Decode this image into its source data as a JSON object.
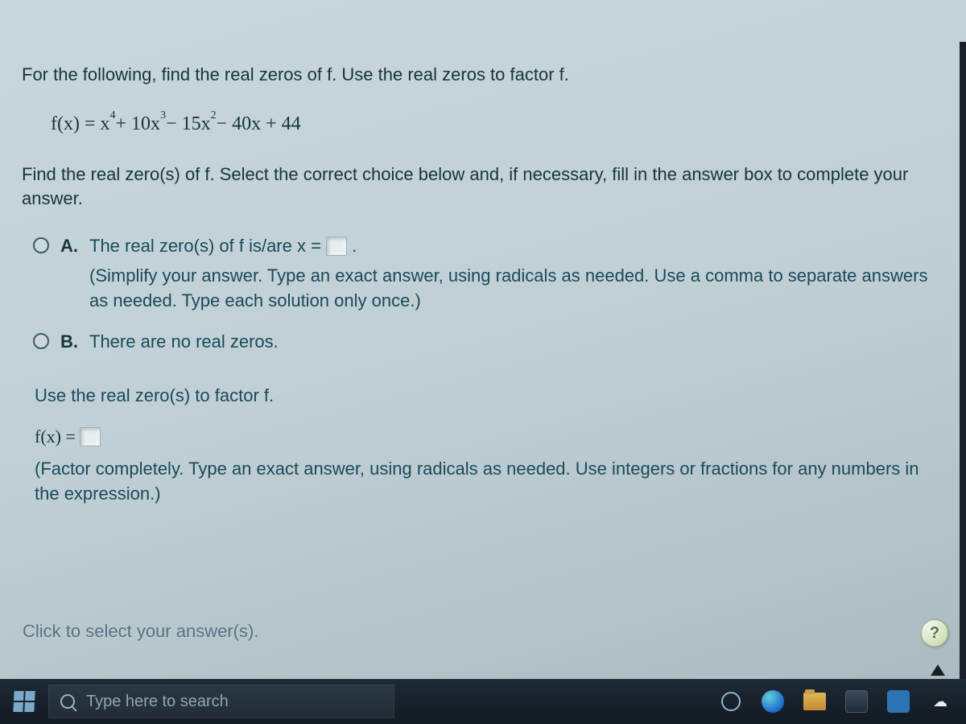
{
  "question": {
    "prompt1": "For the following, find the real zeros of f. Use the real zeros to factor f.",
    "equation_prefix": "f(x) = x",
    "equation_rest_1": " + 10x",
    "equation_rest_2": " − 15x",
    "equation_rest_3": " − 40x + 44",
    "exp4": "4",
    "exp3": "3",
    "exp2": "2",
    "prompt2": "Find the real zero(s) of f. Select the correct choice below and, if necessary, fill in the answer box to complete your answer.",
    "choices": {
      "A": {
        "letter": "A.",
        "line1_before": "The real zero(s) of f is/are x = ",
        "period": ".",
        "hint": "(Simplify your answer. Type an exact answer, using radicals as needed. Use a comma to separate answers as needed. Type each solution only once.)"
      },
      "B": {
        "letter": "B.",
        "text": "There are no real zeros."
      }
    },
    "section2": "Use the real zero(s) to factor f.",
    "factor_lhs": "f(x) = ",
    "factor_hint": "(Factor completely. Type an exact answer, using radicals as needed. Use integers or fractions for any numbers in the expression.)",
    "footer_hint": "Click to select your answer(s).",
    "help": "?"
  },
  "taskbar": {
    "search_placeholder": "Type here to search"
  }
}
